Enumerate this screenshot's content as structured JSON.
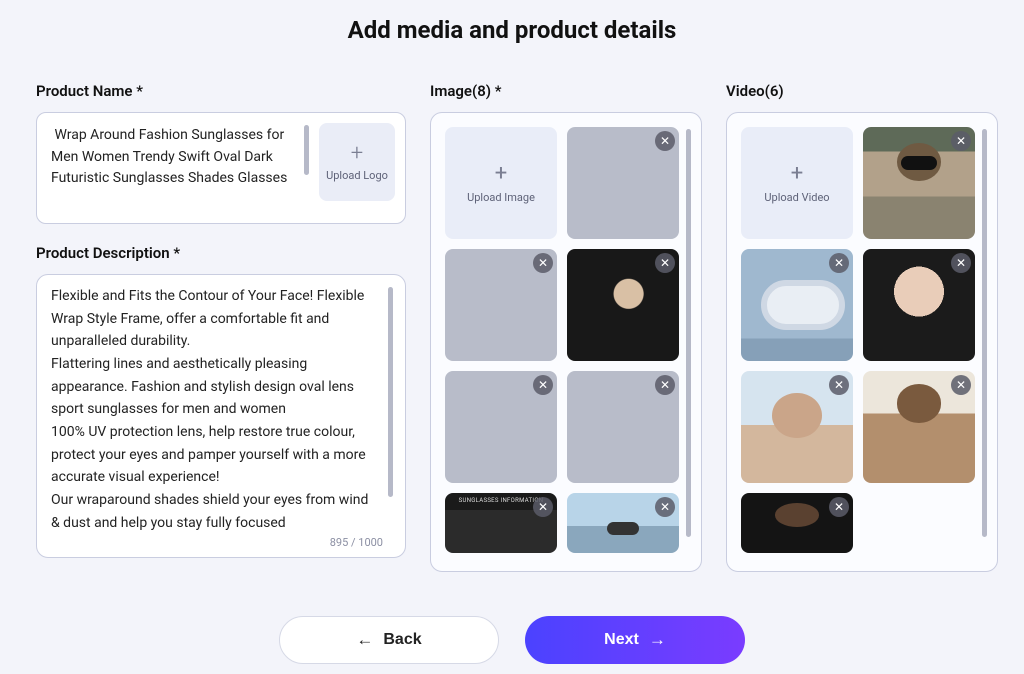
{
  "page_title": "Add media and product details",
  "product_name": {
    "label": "Product Name *",
    "value": " Wrap Around Fashion Sunglasses for Men Women Trendy Swift Oval Dark Futuristic Sunglasses Shades Glasses",
    "upload_logo_label": "Upload Logo"
  },
  "product_description": {
    "label": "Product Description *",
    "value": "Flexible and Fits the Contour of Your Face! Flexible Wrap Style Frame, offer a comfortable fit and unparalleled durability.\nFlattering lines and aesthetically pleasing appearance. Fashion and stylish design oval lens sport sunglasses for men and women\n100% UV protection lens, help restore true colour, protect your eyes and pamper yourself with a more accurate visual experience!\nOur wraparound shades shield your eyes from wind & dust and help you stay fully focused",
    "char_count": "895 / 1000"
  },
  "images": {
    "label": "Image(8) *",
    "upload_label": "Upload Image"
  },
  "videos": {
    "label": "Video(6)",
    "upload_label": "Upload Video"
  },
  "buttons": {
    "back": "Back",
    "next": "Next"
  }
}
